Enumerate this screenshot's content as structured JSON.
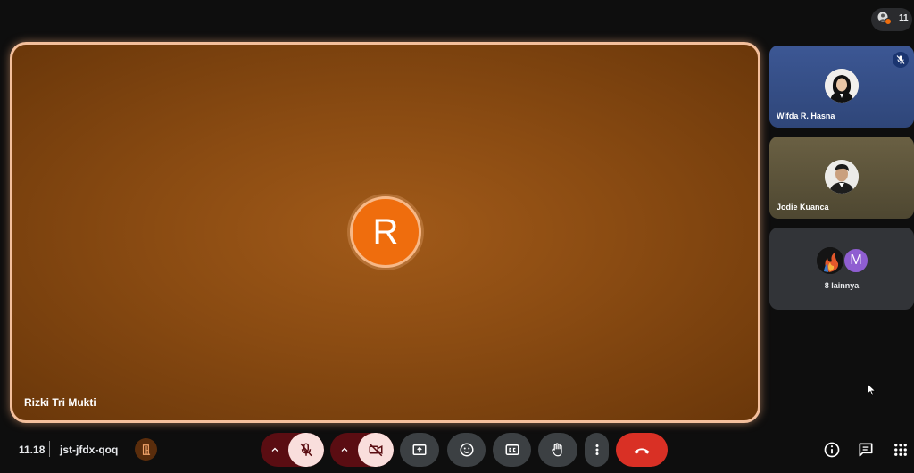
{
  "header": {
    "participant_count": "11"
  },
  "main_tile": {
    "avatar_letter": "R",
    "name": "Rizki Tri Mukti"
  },
  "side_tiles": [
    {
      "name": "Wifda R. Hasna",
      "muted": true
    },
    {
      "name": "Jodie Kuanca"
    },
    {
      "avatar_letter": "M",
      "label": "8 lainnya"
    }
  ],
  "meeting": {
    "time": "11.18",
    "code": "jst-jfdx-qoq"
  },
  "toolbar": {
    "buttons": [
      "mic-options",
      "mic-muted",
      "camera-options",
      "camera-off",
      "present-screen",
      "emoji-reactions",
      "captions",
      "raise-hand",
      "more-options",
      "leave-call"
    ]
  },
  "colors": {
    "main_bg": "#8a4b12",
    "active_border": "#f3bf9c",
    "avatar_orange": "#ef6d0d",
    "muted_red_dark": "#5a0d12",
    "muted_pink": "#f9dedc",
    "end_call_red": "#d93025",
    "control_gray": "#3c4043"
  }
}
